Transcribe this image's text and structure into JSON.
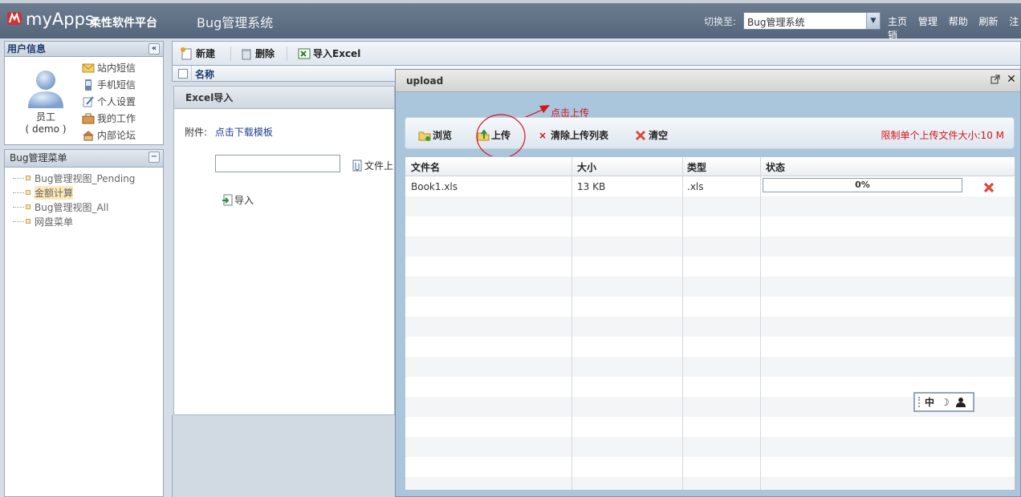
{
  "header": {
    "brand": "myApps",
    "brand_cn": "柔性软件平台",
    "system_title": "Bug管理系统",
    "switch_label": "切换至:",
    "switch_value": "Bug管理系统",
    "nav": [
      "主页",
      "管理",
      "帮助",
      "刷新",
      "注销"
    ]
  },
  "user_panel": {
    "title": "用户信息",
    "name": "员工",
    "account": "( demo )",
    "links": [
      "站内短信",
      "手机短信",
      "个人设置",
      "我的工作",
      "内部论坛"
    ]
  },
  "menu_panel": {
    "title": "Bug管理菜单",
    "items": [
      "Bug管理视图_Pending",
      "金额计算",
      "Bug管理视图_All",
      "网盘菜单"
    ]
  },
  "toolbar": {
    "new_label": "新建",
    "delete_label": "删除",
    "import_label": "导入Excel"
  },
  "grid": {
    "col_name": "名称"
  },
  "excel_panel": {
    "title": "Excel导入",
    "attach_label": "附件:",
    "download_link": "点击下载模板",
    "upload_label": "文件上",
    "import_label": "导入"
  },
  "dialog": {
    "title": "upload",
    "callout": "点击上传",
    "buttons": {
      "browse": "浏览",
      "upload": "上传",
      "clear_list": "清除上传列表",
      "clear": "清空"
    },
    "limit": "限制单个上传文件大小:10 M",
    "columns": [
      "文件名",
      "大小",
      "类型",
      "状态"
    ],
    "files": [
      {
        "name": "Book1.xls",
        "size": "13 KB",
        "type": ".xls",
        "status": "0%"
      }
    ]
  },
  "ime": {
    "lang": "中"
  }
}
